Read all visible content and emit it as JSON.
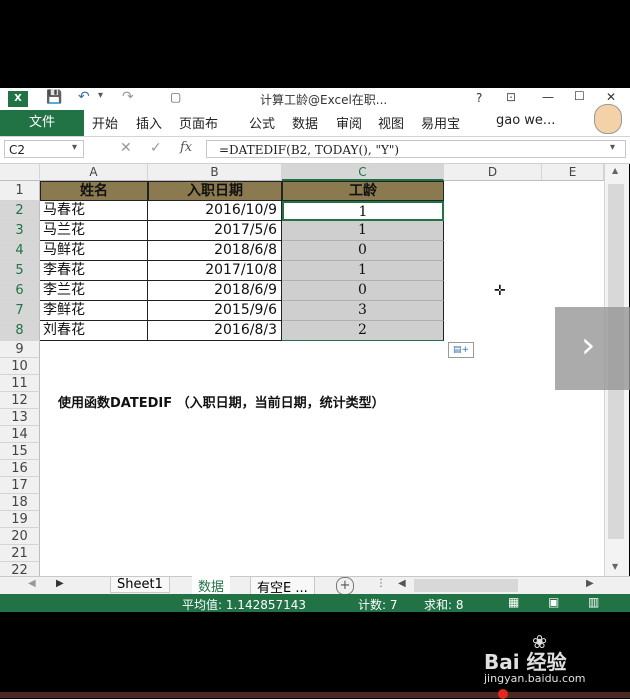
{
  "titlebar": {
    "title": "计算工龄@Excel在职...",
    "help": "?",
    "minimize": "—",
    "maximize": "☐",
    "close": "✕"
  },
  "ribbon": {
    "file_tab": "文件",
    "tabs": [
      "开始",
      "插入",
      "页面布",
      "公式",
      "数据",
      "审阅",
      "视图",
      "易用宝"
    ],
    "user": "gao we..."
  },
  "formula_bar": {
    "name_box": "C2",
    "fx": "fx",
    "formula": "=DATEDIF(B2, TODAY(), \"Y\")"
  },
  "columns": [
    "A",
    "B",
    "C",
    "D",
    "E"
  ],
  "rows": [
    "1",
    "2",
    "3",
    "4",
    "5",
    "6",
    "7",
    "8",
    "9",
    "10",
    "11",
    "12",
    "13",
    "14",
    "15",
    "16",
    "17",
    "18",
    "19",
    "20",
    "21",
    "22"
  ],
  "table": {
    "headers": [
      "姓名",
      "入职日期",
      "工龄"
    ],
    "records": [
      {
        "name": "马春花",
        "date": "2016/10/9",
        "age": "1"
      },
      {
        "name": "马兰花",
        "date": "2017/5/6",
        "age": "1"
      },
      {
        "name": "马鲜花",
        "date": "2018/6/8",
        "age": "0"
      },
      {
        "name": "李春花",
        "date": "2017/10/8",
        "age": "1"
      },
      {
        "name": "李兰花",
        "date": "2018/6/9",
        "age": "0"
      },
      {
        "name": "李鲜花",
        "date": "2015/9/6",
        "age": "3"
      },
      {
        "name": "刘春花",
        "date": "2016/8/3",
        "age": "2"
      }
    ]
  },
  "note": "使用函数DATEDIF （入职日期，当前日期，统计类型）",
  "sheet_tabs": [
    "Sheet1",
    "数据",
    "有空E ..."
  ],
  "status": {
    "average": "平均值: 1.142857143",
    "count": "计数: 7",
    "sum": "求和: 8"
  },
  "watermark": {
    "brand": "Bai 经验",
    "url": "jingyan.baidu.com"
  },
  "colors": {
    "excel_green": "#217346",
    "header_fill": "#8b7a4f",
    "selection_fill": "#cfcfcf"
  }
}
